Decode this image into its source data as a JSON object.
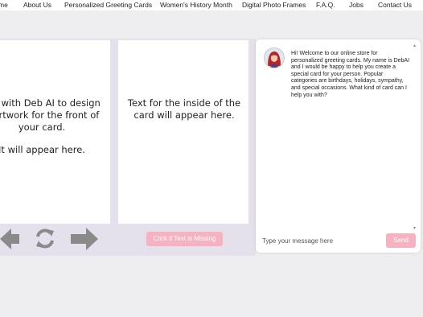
{
  "nav": {
    "items": [
      "me",
      "About Us",
      "Personalized Greeting Cards",
      "Women's History Month",
      "Digital Photo Frames",
      "F.A.Q.",
      "Jobs",
      "Contact Us"
    ]
  },
  "front_card": {
    "text_lines": [
      "hat with Deb AI to design",
      "e artwork for the front of",
      "your card."
    ],
    "text_line2": "It will appear here."
  },
  "inside_card": {
    "text_lines": [
      "Text for the inside of the",
      "card will appear here."
    ]
  },
  "missing_button_label": "Click if Text is Missing",
  "controls": {
    "left_icon": "arrow-left-icon",
    "refresh_icon": "refresh-icon",
    "right_icon": "arrow-right-icon"
  },
  "chat": {
    "message": "Hi! Welcome to our online store for personalized greeting cards. My name is DebAI and I would be happy to help you create a special card for your person. Popular categories are birthdays, holidays, sympathy, and special occasions. What kind of card can I help you with?",
    "input_placeholder": "Type your message here",
    "send_label": "Send"
  },
  "colors": {
    "accent_pink": "#f7b2c2",
    "panel_lavender": "#e5e1ec",
    "control_gray": "#8a8a8a"
  }
}
